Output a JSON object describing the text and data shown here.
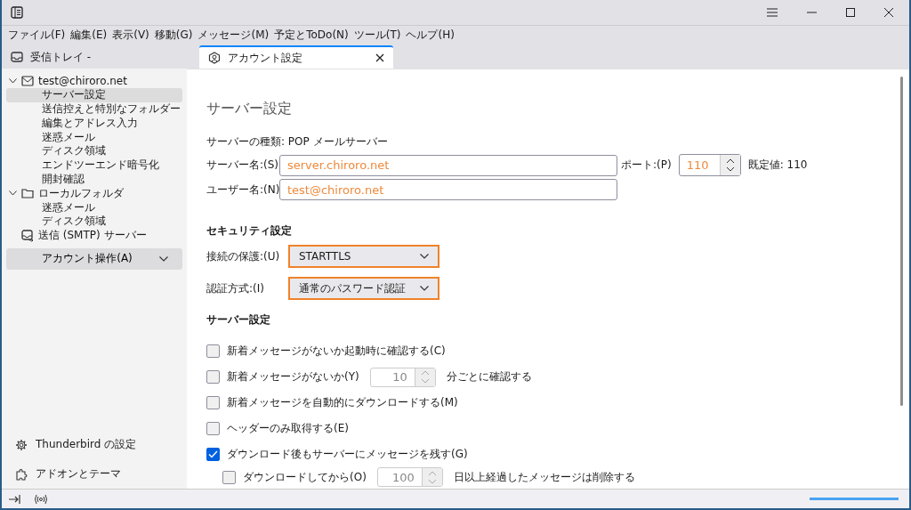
{
  "menu_bar": [
    "ファイル(F)",
    "編集(E)",
    "表示(V)",
    "移動(G)",
    "メッセージ(M)",
    "予定とToDo(N)",
    "ツール(T)",
    "ヘルプ(H)"
  ],
  "tabs": [
    {
      "label": "受信トレイ -",
      "kind": "inbox",
      "selected": false
    },
    {
      "label": "アカウント設定",
      "kind": "account",
      "selected": true
    }
  ],
  "sidebar": {
    "tree": [
      {
        "label": "test@chiroro.net",
        "kind": "account",
        "expanded": true,
        "selected": false,
        "children": [
          {
            "label": "サーバー設定",
            "selected": true
          },
          {
            "label": "送信控えと特別なフォルダー",
            "selected": false
          },
          {
            "label": "編集とアドレス入力",
            "selected": false
          },
          {
            "label": "迷惑メール",
            "selected": false
          },
          {
            "label": "ディスク領域",
            "selected": false
          },
          {
            "label": "エンドツーエンド暗号化",
            "selected": false
          },
          {
            "label": "開封確認",
            "selected": false
          }
        ]
      },
      {
        "label": "ローカルフォルダ",
        "kind": "folder",
        "expanded": true,
        "selected": false,
        "children": [
          {
            "label": "迷惑メール",
            "selected": false
          },
          {
            "label": "ディスク領域",
            "selected": false
          }
        ]
      },
      {
        "label": "送信 (SMTP) サーバー",
        "kind": "smtp",
        "selected": false
      }
    ],
    "account_actions": "アカウント操作(A)",
    "footer": [
      {
        "label": "Thunderbird の設定",
        "kind": "gear"
      },
      {
        "label": "アドオンとテーマ",
        "kind": "puzzle"
      }
    ]
  },
  "content": {
    "title": "サーバー設定",
    "server_type": "サーバーの種類: POP メールサーバー",
    "server_name": {
      "label": "サーバー名:(S)",
      "value": "server.chiroro.net"
    },
    "port": {
      "label": "ポート:(P)",
      "value": "110",
      "default": "既定値: 110"
    },
    "user_name": {
      "label": "ユーザー名:(N)",
      "value": "test@chiroro.net"
    },
    "security_heading": "セキュリティ設定",
    "security": [
      {
        "label": "接続の保護:(U)",
        "value": "STARTTLS",
        "highlighted": true
      },
      {
        "label": "認証方式:(I)",
        "value": "通常のパスワード認証",
        "highlighted": true
      }
    ],
    "server_heading": "サーバー設定",
    "options": [
      {
        "kind": "check",
        "label": "新着メッセージがないか起動時に確認する(C)",
        "checked": false
      },
      {
        "kind": "spin",
        "label": "新着メッセージがないか(Y)",
        "checked": false,
        "spin": "10",
        "suffix": "分ごとに確認する"
      },
      {
        "kind": "check",
        "label": "新着メッセージを自動的にダウンロードする(M)",
        "checked": false
      },
      {
        "kind": "check",
        "label": "ヘッダーのみ取得する(E)",
        "checked": false
      },
      {
        "kind": "check",
        "label": "ダウンロード後もサーバーにメッセージを残す(G)",
        "checked": true,
        "children": [
          {
            "kind": "spin",
            "label": "ダウンロードしてから(O)",
            "checked": false,
            "spin": "100",
            "suffix": "日以上経過したメッセージは削除する"
          }
        ]
      }
    ]
  },
  "status_bar": {
    "progress": {
      "level": 1
    }
  }
}
